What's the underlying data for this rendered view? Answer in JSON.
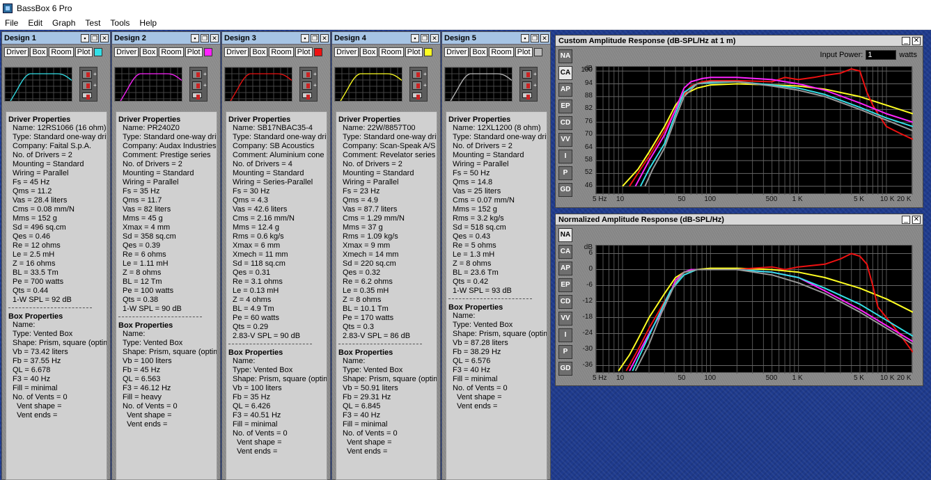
{
  "app": {
    "title": "BassBox 6 Pro"
  },
  "menu": [
    "File",
    "Edit",
    "Graph",
    "Test",
    "Tools",
    "Help"
  ],
  "tabs": [
    "Driver",
    "Box",
    "Room",
    "Plot"
  ],
  "designs": [
    {
      "title": "Design 1",
      "color": "#33e0e8",
      "driver_header": "Driver Properties",
      "driver": [
        "Name: 12RS1066 (16 ohm)",
        "Type: Standard one-way driver",
        "Company: Faital S.p.A.",
        "No. of Drivers = 2",
        "Mounting = Standard",
        "Wiring = Parallel",
        "Fs = 45 Hz",
        "Qms = 11.2",
        "Vas = 28.4 liters",
        "Cms = 0.08 mm/N",
        "Mms = 152 g",
        "Sd = 496 sq.cm",
        "Qes = 0.46",
        "Re = 12 ohms",
        "Le = 2.5 mH",
        "Z = 16 ohms",
        "BL = 33.5 Tm",
        "Pe = 700 watts",
        "Qts = 0.44",
        "1-W SPL = 92 dB"
      ],
      "box_header": "Box Properties",
      "box": [
        "Name:",
        "Type: Vented Box",
        "Shape: Prism, square (optimum)",
        "Vb = 73.42 liters",
        "Fb = 37.55 Hz",
        "QL = 6.678",
        "F3 = 40 Hz",
        "Fill = minimal",
        "No. of Vents = 0"
      ],
      "vent": [
        "Vent shape =",
        "Vent ends ="
      ]
    },
    {
      "title": "Design 2",
      "color": "#ff22ff",
      "driver_header": "Driver Properties",
      "driver": [
        "Name: PR240Z0",
        "Type: Standard one-way driver",
        "Company: Audax Industries",
        "Comment: Prestige series",
        "No. of Drivers = 2",
        "Mounting = Standard",
        "Wiring = Parallel",
        "Fs = 35 Hz",
        "Qms = 11.7",
        "Vas = 82 liters",
        "Mms = 45 g",
        "Xmax = 4 mm",
        "Sd = 358 sq.cm",
        "Qes = 0.39",
        "Re = 6 ohms",
        "Le = 1.11 mH",
        "Z = 8 ohms",
        "BL = 12 Tm",
        "Pe = 100 watts",
        "Qts = 0.38",
        "1-W SPL = 90 dB"
      ],
      "box_header": "Box Properties",
      "box": [
        "Name:",
        "Type: Vented Box",
        "Shape: Prism, square (optimum)",
        "Vb = 100 liters",
        "Fb = 45 Hz",
        "QL = 6.563",
        "F3 = 46.12 Hz",
        "Fill = heavy",
        "No. of Vents = 0"
      ],
      "vent": [
        "Vent shape =",
        "Vent ends ="
      ]
    },
    {
      "title": "Design 3",
      "color": "#ee1111",
      "driver_header": "Driver Properties",
      "driver": [
        "Name: SB17NBAC35-4",
        "Type: Standard one-way driver",
        "Company: SB Acoustics",
        "Comment: Aluminium cone",
        "No. of Drivers = 4",
        "Mounting = Standard",
        "Wiring = Series-Parallel",
        "Fs = 30 Hz",
        "Qms = 4.3",
        "Vas = 42.6 liters",
        "Cms = 2.16 mm/N",
        "Mms = 12.4 g",
        "Rms = 0.6 kg/s",
        "Xmax = 6 mm",
        "Xmech = 11 mm",
        "Sd = 118 sq.cm",
        "Qes = 0.31",
        "Re = 3.1 ohms",
        "Le = 0.13 mH",
        "Z = 4 ohms",
        "BL = 4.9 Tm",
        "Pe = 60 watts",
        "Qts = 0.29",
        "2.83-V SPL = 90 dB"
      ],
      "box_header": "Box Properties",
      "box": [
        "Name:",
        "Type: Vented Box",
        "Shape: Prism, square (optimum)",
        "Vb = 100 liters",
        "Fb = 35 Hz",
        "QL = 6.426",
        "F3 = 40.51 Hz",
        "Fill = minimal",
        "No. of Vents = 0"
      ],
      "vent": [
        "Vent shape =",
        "Vent ends ="
      ]
    },
    {
      "title": "Design 4",
      "color": "#ffff22",
      "driver_header": "Driver Properties",
      "driver": [
        "Name: 22W/8857T00",
        "Type: Standard one-way driver",
        "Company: Scan-Speak A/S",
        "Comment: Revelator series",
        "No. of Drivers = 2",
        "Mounting = Standard",
        "Wiring = Parallel",
        "Fs = 23 Hz",
        "Qms = 4.9",
        "Vas = 87.7 liters",
        "Cms = 1.29 mm/N",
        "Mms = 37 g",
        "Rms = 1.09 kg/s",
        "Xmax = 9 mm",
        "Xmech = 14 mm",
        "Sd = 220 sq.cm",
        "Qes = 0.32",
        "Re = 6.2 ohms",
        "Le = 0.35 mH",
        "Z = 8 ohms",
        "BL = 10.1 Tm",
        "Pe = 170 watts",
        "Qts = 0.3",
        "2.83-V SPL = 86 dB"
      ],
      "box_header": "Box Properties",
      "box": [
        "Name:",
        "Type: Vented Box",
        "Shape: Prism, square (optimum)",
        "Vb = 50.91 liters",
        "Fb = 29.31 Hz",
        "QL = 6.845",
        "F3 = 40 Hz",
        "Fill = minimal",
        "No. of Vents = 0"
      ],
      "vent": [
        "Vent shape =",
        "Vent ends ="
      ]
    },
    {
      "title": "Design 5",
      "color": "#bbbbbb",
      "driver_header": "Driver Properties",
      "driver": [
        "Name: 12XL1200 (8 ohm)",
        "Type: Standard one-way driver",
        "No. of Drivers = 2",
        "Mounting = Standard",
        "Wiring = Parallel",
        "Fs = 50 Hz",
        "Qms = 14.8",
        "Vas = 25 liters",
        "Cms = 0.07 mm/N",
        "Mms = 152 g",
        "Rms = 3.2 kg/s",
        "Sd = 518 sq.cm",
        "Qes = 0.43",
        "Re = 5 ohms",
        "Le = 1.3 mH",
        "Z = 8 ohms",
        "BL = 23.6 Tm",
        "Qts = 0.42",
        "1-W SPL = 93 dB"
      ],
      "box_header": "Box Properties",
      "box": [
        "Name:",
        "Type: Vented Box",
        "Shape: Prism, square (optimum)",
        "Vb = 87.28 liters",
        "Fb = 38.29 Hz",
        "QL = 6.576",
        "F3 = 40 Hz",
        "Fill = minimal",
        "No. of Vents = 0"
      ],
      "vent": [
        "Vent shape =",
        "Vent ends ="
      ]
    }
  ],
  "graph_tabs": [
    "NA",
    "CA",
    "AP",
    "EP",
    "CD",
    "VV",
    "I",
    "P",
    "GD"
  ],
  "graphs": {
    "custom": {
      "title": "Custom Amplitude Response (dB-SPL/Hz at 1 m)",
      "active_tab": "CA",
      "input_power_label": "Input Power:",
      "input_power_value": "1",
      "input_power_unit": "watts"
    },
    "normalized": {
      "title": "Normalized Amplitude Response (dB-SPL/Hz)",
      "active_tab": "NA"
    }
  },
  "chart_data": [
    {
      "type": "line",
      "title": "Custom Amplitude Response (dB-SPL/Hz at 1 m)",
      "ylabel": "dB",
      "xscale": "log",
      "xlim": [
        5,
        20000
      ],
      "ylim": [
        42,
        102
      ],
      "xticks": [
        5,
        10,
        50,
        100,
        500,
        1000,
        5000,
        10000,
        20000
      ],
      "xtick_labels": [
        "5 Hz",
        "10",
        "50",
        "100",
        "500",
        "1 K",
        "5 K",
        "10 K",
        "20 K"
      ],
      "yticks": [
        100,
        94,
        88,
        82,
        76,
        70,
        64,
        58,
        52,
        46
      ],
      "ytick_labels": [
        "100",
        "94",
        "88",
        "82",
        "76",
        "70",
        "64",
        "58",
        "52",
        "46"
      ],
      "grid": true,
      "series": [
        {
          "color": "#ffff22",
          "x": [
            10,
            15,
            20,
            30,
            40,
            50,
            70,
            100,
            200,
            500,
            1000,
            2000,
            5000,
            10000,
            20000
          ],
          "y": [
            46,
            54,
            62,
            74,
            84,
            89,
            92,
            93.5,
            94,
            93.5,
            93,
            91.5,
            88,
            84,
            80
          ]
        },
        {
          "color": "#ee1111",
          "x": [
            12,
            16,
            20,
            30,
            40,
            50,
            60,
            80,
            100,
            200,
            500,
            700,
            1000,
            1500,
            2000,
            3000,
            4000,
            5000,
            6000,
            7000,
            8000,
            10000,
            14000,
            20000
          ],
          "y": [
            46,
            54,
            60,
            72,
            82,
            89,
            93,
            95,
            95.5,
            95.5,
            95,
            97,
            96,
            97,
            98,
            99,
            101,
            100,
            90,
            84,
            80,
            74,
            71,
            68
          ]
        },
        {
          "color": "#ff22ff",
          "x": [
            14,
            20,
            30,
            40,
            50,
            60,
            80,
            100,
            200,
            500,
            1000,
            2000,
            5000,
            10000,
            20000
          ],
          "y": [
            46,
            58,
            70,
            82,
            92,
            95,
            96.5,
            97,
            97,
            96,
            94,
            91,
            85,
            80,
            76
          ]
        },
        {
          "color": "#33e0e8",
          "x": [
            16,
            20,
            30,
            40,
            50,
            70,
            100,
            200,
            500,
            1000,
            2000,
            5000,
            10000,
            20000
          ],
          "y": [
            46,
            54,
            66,
            80,
            90,
            94,
            94.5,
            95,
            93.5,
            92,
            89,
            83,
            78,
            74
          ]
        },
        {
          "color": "#999999",
          "x": [
            18,
            22,
            30,
            40,
            50,
            70,
            100,
            200,
            500,
            1000,
            2000,
            5000,
            10000,
            20000
          ],
          "y": [
            46,
            54,
            64,
            78,
            88,
            94,
            95,
            95,
            93,
            91,
            88,
            82,
            77,
            72
          ]
        }
      ]
    },
    {
      "type": "line",
      "title": "Normalized Amplitude Response (dB-SPL/Hz)",
      "ylabel": "dB",
      "xscale": "log",
      "xlim": [
        5,
        20000
      ],
      "ylim": [
        -39,
        9
      ],
      "xticks": [
        5,
        10,
        50,
        100,
        500,
        1000,
        5000,
        10000,
        20000
      ],
      "xtick_labels": [
        "5 Hz",
        "10",
        "50",
        "100",
        "500",
        "1 K",
        "5 K",
        "10 K",
        "20 K"
      ],
      "yticks": [
        6,
        0,
        -6,
        -12,
        -18,
        -24,
        -30,
        -36
      ],
      "ytick_labels": [
        "6",
        "0",
        "-6",
        "-12",
        "-18",
        "-24",
        "-30",
        "-36"
      ],
      "grid": true,
      "series": [
        {
          "color": "#ffff22",
          "x": [
            9,
            12,
            15,
            20,
            30,
            40,
            50,
            70,
            100,
            200,
            500,
            1000,
            2000,
            5000,
            10000,
            20000
          ],
          "y": [
            -38,
            -32,
            -26,
            -18,
            -9,
            -3,
            -1,
            0,
            0.5,
            0.5,
            0,
            -1,
            -3,
            -7,
            -11,
            -16
          ]
        },
        {
          "color": "#ee1111",
          "x": [
            11,
            15,
            20,
            30,
            40,
            50,
            70,
            100,
            200,
            300,
            500,
            700,
            1000,
            2000,
            3000,
            4000,
            5000,
            6000,
            7000,
            8000,
            10000,
            14000,
            20000
          ],
          "y": [
            -38,
            -30,
            -22,
            -12,
            -5,
            -2,
            0,
            0,
            0,
            0.5,
            1,
            0,
            1,
            2,
            4,
            6,
            5,
            2,
            -6,
            -14,
            -18,
            -24,
            -31
          ]
        },
        {
          "color": "#ff22ff",
          "x": [
            12,
            16,
            20,
            30,
            40,
            50,
            60,
            80,
            100,
            200,
            500,
            1000,
            2000,
            5000,
            10000,
            20000
          ],
          "y": [
            -38,
            -30,
            -24,
            -14,
            -4,
            -1,
            0,
            0,
            0,
            0,
            -1,
            -3,
            -8,
            -15,
            -21,
            -27
          ]
        },
        {
          "color": "#33e0e8",
          "x": [
            13,
            18,
            25,
            35,
            50,
            70,
            100,
            200,
            500,
            1000,
            2000,
            5000,
            10000,
            20000
          ],
          "y": [
            -38,
            -28,
            -18,
            -8,
            -2,
            0,
            0,
            0,
            -1,
            -3,
            -7,
            -13,
            -19,
            -25
          ]
        },
        {
          "color": "#999999",
          "x": [
            14,
            20,
            28,
            40,
            50,
            70,
            100,
            200,
            500,
            1000,
            2000,
            5000,
            10000,
            20000
          ],
          "y": [
            -38,
            -28,
            -16,
            -5,
            -1,
            0,
            0,
            0,
            -2,
            -5,
            -9,
            -16,
            -22,
            -28
          ]
        }
      ]
    }
  ]
}
